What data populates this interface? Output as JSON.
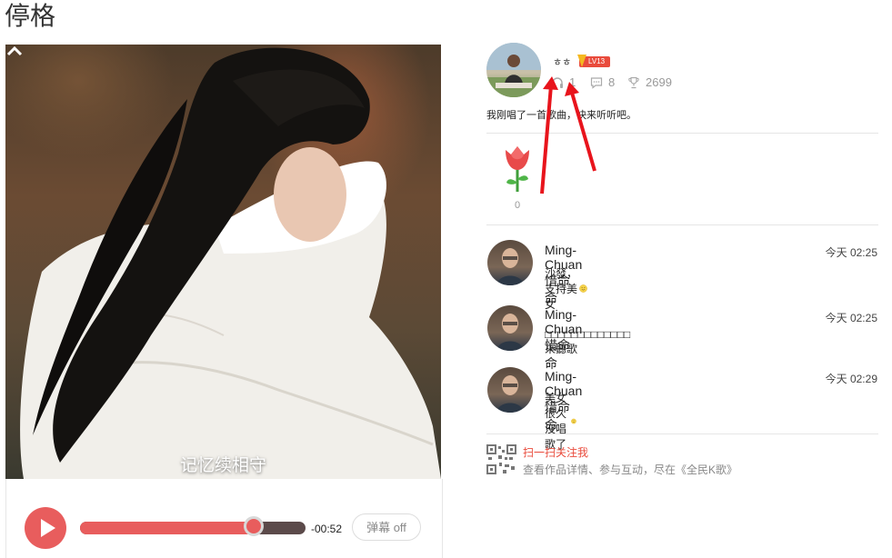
{
  "page": {
    "title": "停格"
  },
  "player": {
    "song_name": "记忆续相守",
    "time": "-00:52",
    "danmu_label": "弹幕 off",
    "progress_fraction": 0.77
  },
  "user": {
    "name": "ㅎㅎ",
    "level": "LV13",
    "stats": {
      "listens": "1",
      "comments": "8",
      "trophies": "2699"
    },
    "description": "我刚唱了一首歌曲，快来听听吧。"
  },
  "gifts": {
    "flower_count": "0"
  },
  "comments": [
    {
      "name": "Ming-Chuan惜命命",
      "time": "今天 02:25",
      "text": "沙發，支持美女",
      "has_emoji": true
    },
    {
      "name": "Ming-Chuan惜命命",
      "time": "今天 02:25",
      "text": "□□□□□□□□□□□□□來聽歌",
      "has_emoji": false
    },
    {
      "name": "Ming-Chuan惜命命",
      "time": "今天 02:29",
      "text": "美女很久沒唱歌了",
      "has_emoji": true
    }
  ],
  "promo": {
    "title": "扫一扫关注我",
    "subtitle": "查看作品详情、参与互动，尽在《全民K歌》"
  },
  "colors": {
    "accent": "#e85d5d",
    "level_badge": "#e94b3c",
    "annotation_arrow": "#e8141c"
  }
}
